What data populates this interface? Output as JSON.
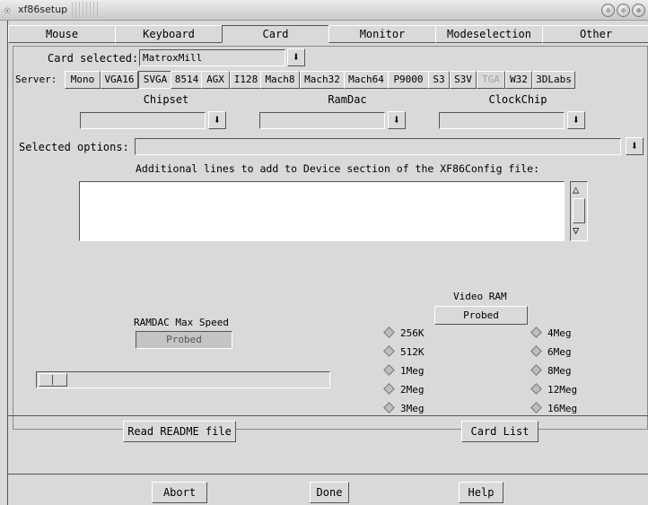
{
  "window": {
    "title": "xf86setup",
    "menu_glyph": "☉",
    "controls": [
      "⊙",
      "⊙",
      "⊗"
    ]
  },
  "tabs": [
    {
      "label": "Mouse"
    },
    {
      "label": "Keyboard"
    },
    {
      "label": "Card"
    },
    {
      "label": "Monitor"
    },
    {
      "label": "Modeselection"
    },
    {
      "label": "Other"
    }
  ],
  "active_tab": "Card",
  "card": {
    "selected_label": "Card selected:",
    "selected_value": "MatroxMill",
    "arrow_glyph": "⬇"
  },
  "server": {
    "label": "Server:",
    "buttons": [
      "Mono",
      "VGA16",
      "SVGA",
      "8514",
      "AGX",
      "I128",
      "Mach8",
      "Mach32",
      "Mach64",
      "P9000",
      "S3",
      "S3V",
      "TGA",
      "W32",
      "3DLabs"
    ],
    "selected": "SVGA",
    "disabled": "TGA"
  },
  "dropdowns": {
    "chipset": {
      "label": "Chipset",
      "value": ""
    },
    "ramdac": {
      "label": "RamDac",
      "value": ""
    },
    "clockchip": {
      "label": "ClockChip",
      "value": ""
    }
  },
  "options": {
    "label": "Selected options:",
    "value": "",
    "additional_label": "Additional lines to add to Device section of the XF86Config file:",
    "text": ""
  },
  "ramdac_speed": {
    "label": "RAMDAC Max Speed",
    "value": "Probed"
  },
  "video_ram": {
    "label": "Video RAM",
    "value": "Probed",
    "left": [
      "256K",
      "512K",
      "1Meg",
      "2Meg",
      "3Meg"
    ],
    "right": [
      "4Meg",
      "6Meg",
      "8Meg",
      "12Meg",
      "16Meg"
    ]
  },
  "buttons": {
    "readme": "Read README file",
    "card_list": "Card List",
    "abort": "Abort",
    "done": "Done",
    "help": "Help"
  },
  "colors": {
    "background": "#d9d9d9",
    "disabled_text": "#a4a4a4"
  }
}
